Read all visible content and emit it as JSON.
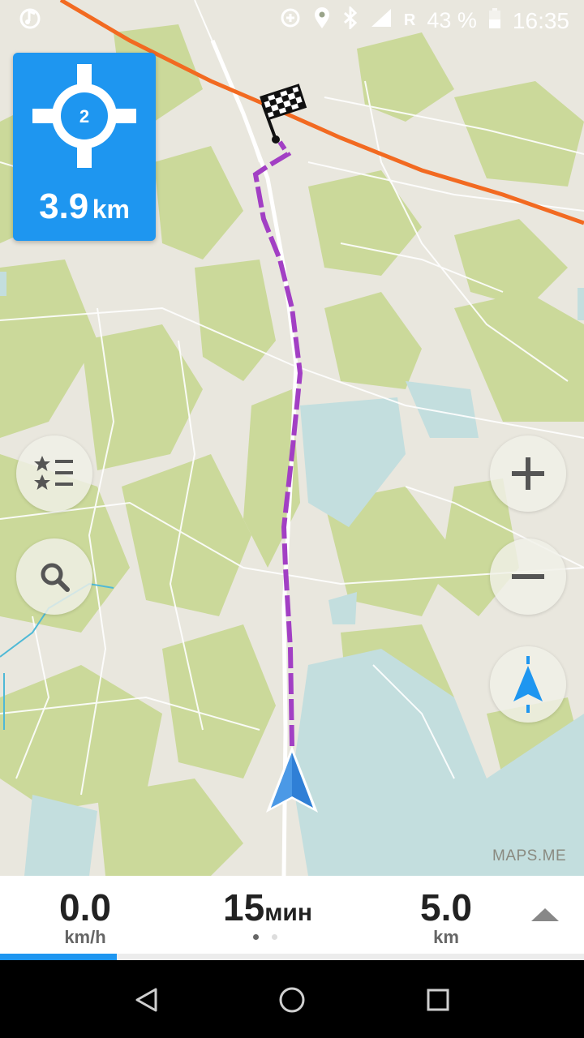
{
  "status_bar": {
    "time": "16:35",
    "battery": "43 %",
    "roaming": "R",
    "icons": [
      "music-note-icon",
      "data-saver-icon",
      "location-pin-icon",
      "bluetooth-icon",
      "cell-signal-icon",
      "battery-icon"
    ]
  },
  "turn": {
    "exit_number": "2",
    "icon": "roundabout-icon",
    "distance_value": "3.9",
    "distance_unit": "km"
  },
  "map": {
    "attribution": "MAPS.ME",
    "route_color": "#a23fc4",
    "highway_color": "#f26a21",
    "park_color": "#cbd99a",
    "water_color": "#c3dede",
    "position_arrow_color": "#2f7fd6"
  },
  "controls": {
    "bookmarks_icon": "star-list-icon",
    "search_icon": "search-icon",
    "zoom_in_icon": "plus-icon",
    "zoom_out_icon": "minus-icon",
    "my_position_icon": "navigation-arrow-icon"
  },
  "bottom_panel": {
    "speed_value": "0.0",
    "speed_unit": "km/h",
    "time_value": "15",
    "time_unit": "мин",
    "distance_value": "5.0",
    "distance_unit": "km",
    "expand_icon": "caret-up-icon",
    "page_count": 2,
    "active_page": 1,
    "route_progress": 0.2
  },
  "accent_color": "#1e96f0",
  "nav_bar": {
    "icons": [
      "back-triangle-icon",
      "home-circle-icon",
      "recents-square-icon"
    ]
  }
}
